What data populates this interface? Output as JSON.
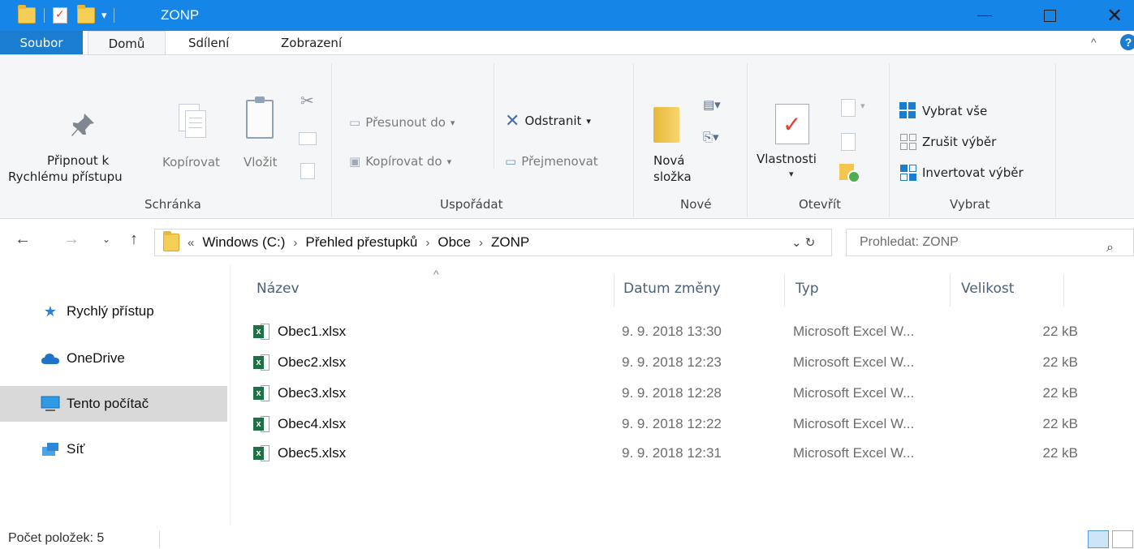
{
  "window": {
    "title": "ZONP",
    "minimize": "—",
    "maximize": "☐",
    "close": "✕"
  },
  "tabs": [
    {
      "label": "Soubor"
    },
    {
      "label": "Domů"
    },
    {
      "label": "Sdílení"
    },
    {
      "label": "Zobrazení"
    }
  ],
  "ribbon": {
    "pin_line1": "Připnout k",
    "pin_line2": "Rychlému přístupu",
    "copy": "Kopírovat",
    "paste": "Vložit",
    "clipboard_group": "Schránka",
    "move_to": "Přesunout do",
    "copy_to": "Kopírovat do",
    "delete": "Odstranit",
    "rename": "Přejmenovat",
    "organize_group": "Uspořádat",
    "new_folder_line1": "Nová",
    "new_folder_line2": "složka",
    "new_group": "Nové",
    "properties": "Vlastnosti",
    "open_group": "Otevřít",
    "select_all": "Vybrat vše",
    "select_none": "Zrušit výběr",
    "invert_selection": "Invertovat výběr",
    "select_group": "Vybrat"
  },
  "address": {
    "overflow": "«",
    "crumbs": [
      "Windows (C:)",
      "Přehled přestupků",
      "Obce",
      "ZONP"
    ],
    "search_placeholder": "Prohledat: ZONP"
  },
  "nav": [
    {
      "label": "Rychlý přístup",
      "icon": "star-icon"
    },
    {
      "label": "OneDrive",
      "icon": "cloud-icon"
    },
    {
      "label": "Tento počítač",
      "icon": "computer-icon"
    },
    {
      "label": "Síť",
      "icon": "network-icon"
    }
  ],
  "columns": {
    "name": "Název",
    "date": "Datum změny",
    "type": "Typ",
    "size": "Velikost"
  },
  "files": [
    {
      "name": "Obec1.xlsx",
      "date": "9. 9. 2018 13:30",
      "type": "Microsoft Excel W...",
      "size": "22 kB"
    },
    {
      "name": "Obec2.xlsx",
      "date": "9. 9. 2018 12:23",
      "type": "Microsoft Excel W...",
      "size": "22 kB"
    },
    {
      "name": "Obec3.xlsx",
      "date": "9. 9. 2018 12:28",
      "type": "Microsoft Excel W...",
      "size": "22 kB"
    },
    {
      "name": "Obec4.xlsx",
      "date": "9. 9. 2018 12:22",
      "type": "Microsoft Excel W...",
      "size": "22 kB"
    },
    {
      "name": "Obec5.xlsx",
      "date": "9. 9. 2018 12:31",
      "type": "Microsoft Excel W...",
      "size": "22 kB"
    }
  ],
  "status": {
    "item_count": "Počet položek: 5"
  },
  "colors": {
    "titlebar": "#1685e8",
    "file_tab": "#1a7dd0",
    "selected_nav": "#d9d9d9"
  }
}
